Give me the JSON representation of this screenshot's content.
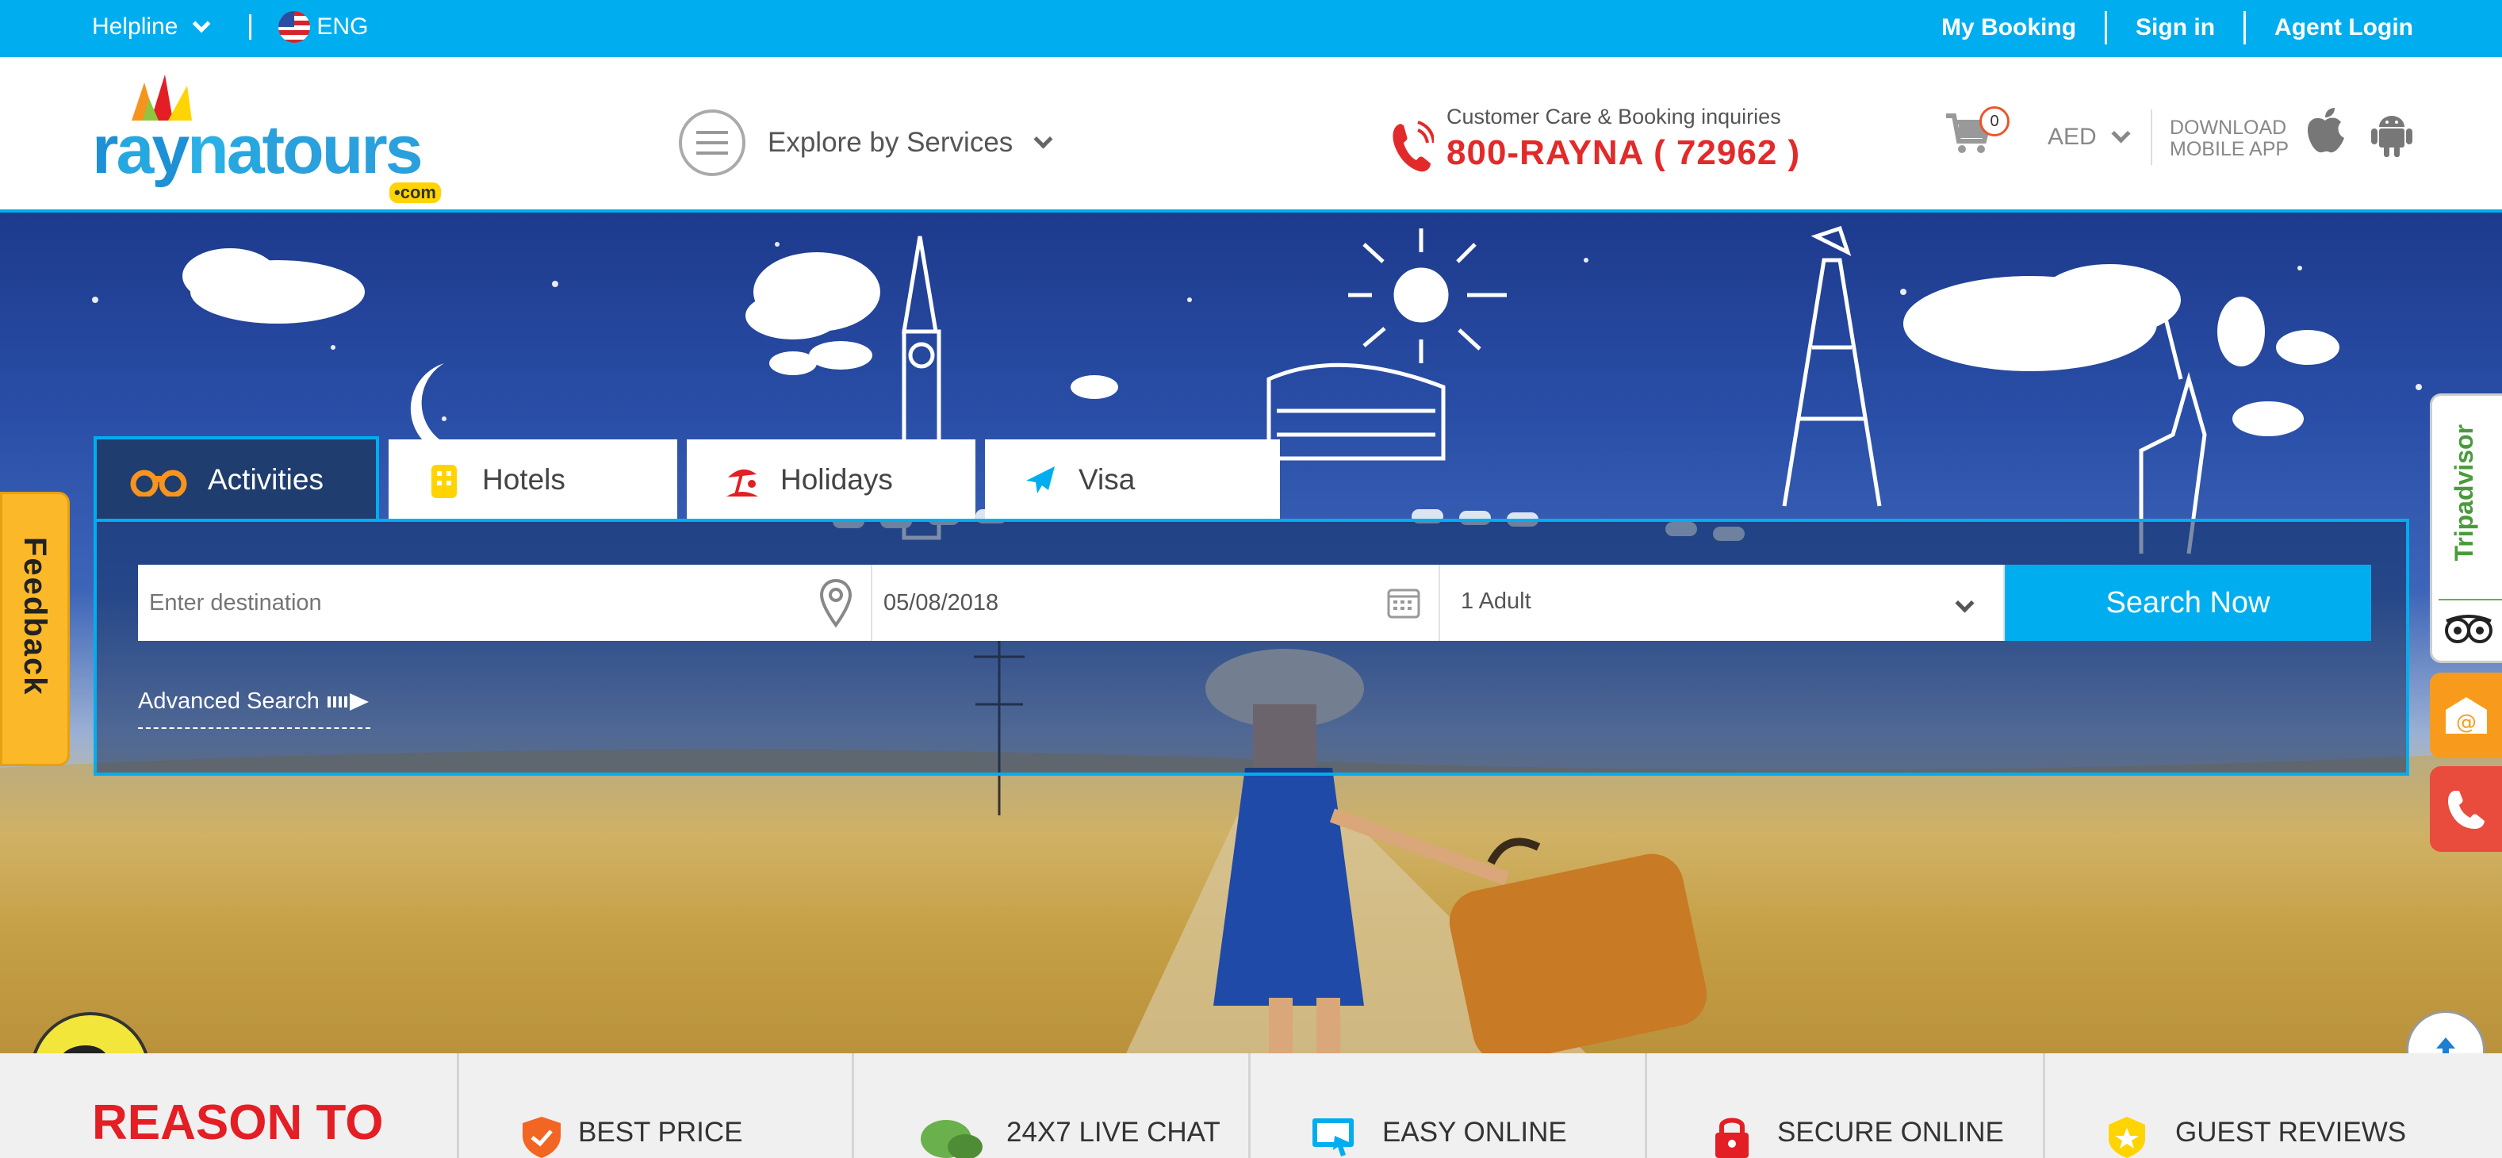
{
  "topbar": {
    "helpline": "Helpline",
    "language": "ENG",
    "my_booking": "My Booking",
    "sign_in": "Sign in",
    "agent_login": "Agent Login"
  },
  "header": {
    "logo_text": "raynatours",
    "logo_suffix": "•com",
    "explore_label": "Explore by Services",
    "care_label": "Customer Care & Booking inquiries",
    "care_phone": "800-RAYNA ( 72962 )",
    "cart_count": "0",
    "currency": "AED",
    "download_line1": "DOWNLOAD",
    "download_line2": "MOBILE APP"
  },
  "search": {
    "tabs": [
      {
        "label": "Activities",
        "icon": "binoculars-icon",
        "active": true
      },
      {
        "label": "Hotels",
        "icon": "building-icon",
        "active": false
      },
      {
        "label": "Holidays",
        "icon": "beach-umbrella-icon",
        "active": false
      },
      {
        "label": "Visa",
        "icon": "airplane-icon",
        "active": false
      }
    ],
    "destination_placeholder": "Enter destination",
    "date_value": "05/08/2018",
    "pax_value": "1 Adult",
    "search_button": "Search Now",
    "advanced_search": "Advanced Search"
  },
  "feedback_label": "Feedback",
  "side": {
    "tripadvisor_label": "Tripadvisor"
  },
  "reasons": {
    "title": "REASON TO",
    "items": [
      {
        "label": "BEST PRICE",
        "icon": "shield-check-icon"
      },
      {
        "label": "24X7 LIVE CHAT",
        "icon": "chat-bubbles-icon"
      },
      {
        "label": "EASY ONLINE",
        "icon": "monitor-icon"
      },
      {
        "label": "SECURE ONLINE",
        "icon": "lock-icon"
      },
      {
        "label": "GUEST REVIEWS",
        "icon": "star-badge-icon"
      }
    ]
  },
  "colors": {
    "brand_blue": "#00aeef",
    "accent_red": "#e22a2a",
    "feedback_yellow": "#fbb92a",
    "tab_dark": "#1f3d6e"
  }
}
